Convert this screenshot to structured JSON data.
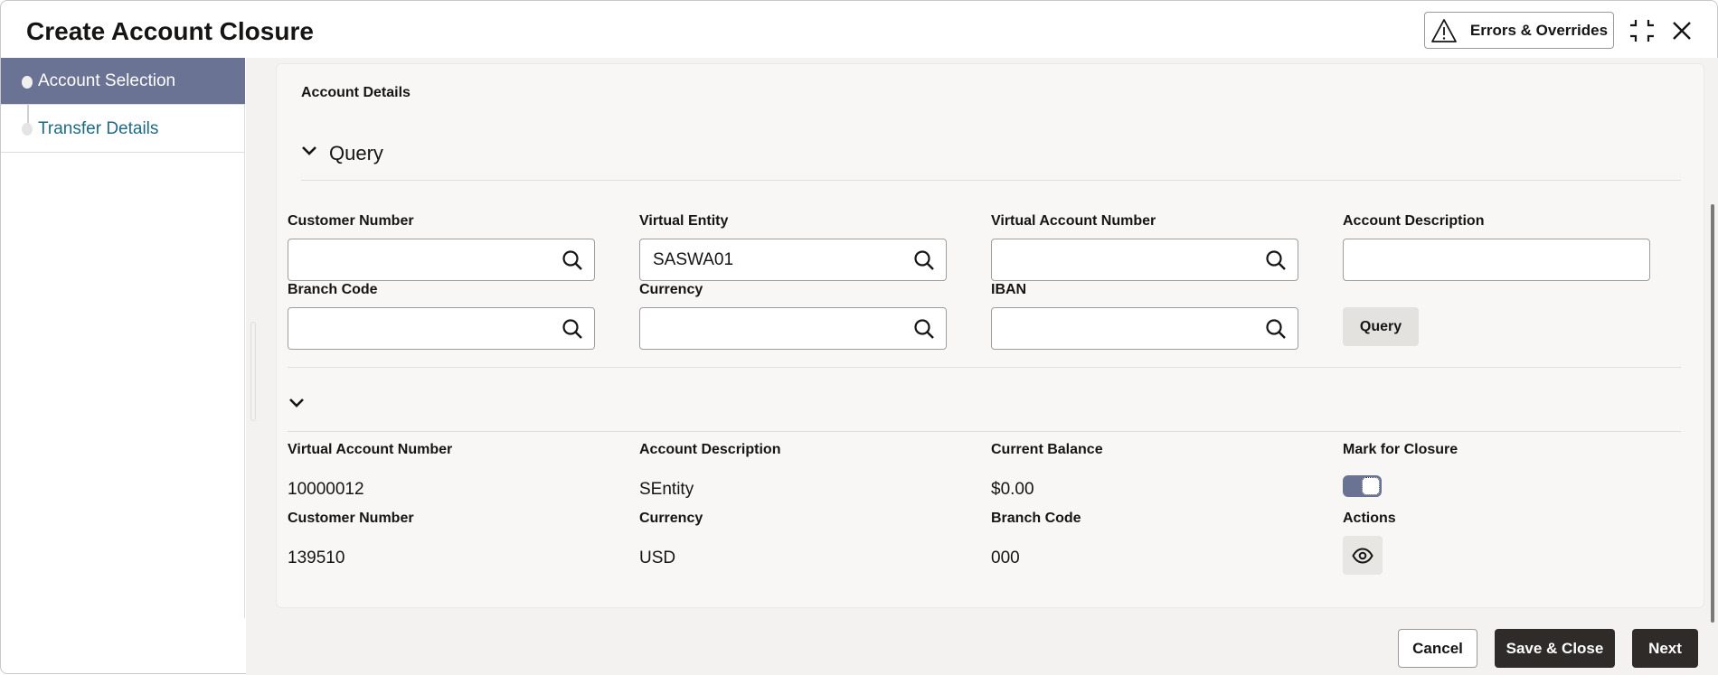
{
  "header": {
    "title": "Create Account Closure",
    "errors_label": "Errors & Overrides"
  },
  "sidebar": {
    "items": [
      {
        "label": "Account Selection",
        "active": true
      },
      {
        "label": "Transfer Details",
        "active": false
      }
    ]
  },
  "section": {
    "title": "Account Details",
    "query_title": "Query"
  },
  "query_form": {
    "customer_number": {
      "label": "Customer Number",
      "value": ""
    },
    "virtual_entity": {
      "label": "Virtual Entity",
      "value": "SASWA01"
    },
    "virtual_account_number": {
      "label": "Virtual Account Number",
      "value": ""
    },
    "account_description": {
      "label": "Account Description",
      "value": ""
    },
    "branch_code": {
      "label": "Branch Code",
      "value": ""
    },
    "currency": {
      "label": "Currency",
      "value": ""
    },
    "iban": {
      "label": "IBAN",
      "value": ""
    },
    "query_button": "Query"
  },
  "result": {
    "virtual_account_number": {
      "label": "Virtual Account Number",
      "value": "10000012"
    },
    "account_description": {
      "label": "Account Description",
      "value": "SEntity"
    },
    "current_balance": {
      "label": "Current Balance",
      "value": "$0.00"
    },
    "mark_for_closure": {
      "label": "Mark for Closure",
      "on": true
    },
    "customer_number": {
      "label": "Customer Number",
      "value": "139510"
    },
    "currency": {
      "label": "Currency",
      "value": "USD"
    },
    "branch_code": {
      "label": "Branch Code",
      "value": "000"
    },
    "actions": {
      "label": "Actions"
    }
  },
  "footer": {
    "cancel": "Cancel",
    "save_close": "Save & Close",
    "next": "Next"
  },
  "colors": {
    "accent": "#6b7394",
    "dark_button": "#2e2b28",
    "link": "#1d6a82"
  }
}
